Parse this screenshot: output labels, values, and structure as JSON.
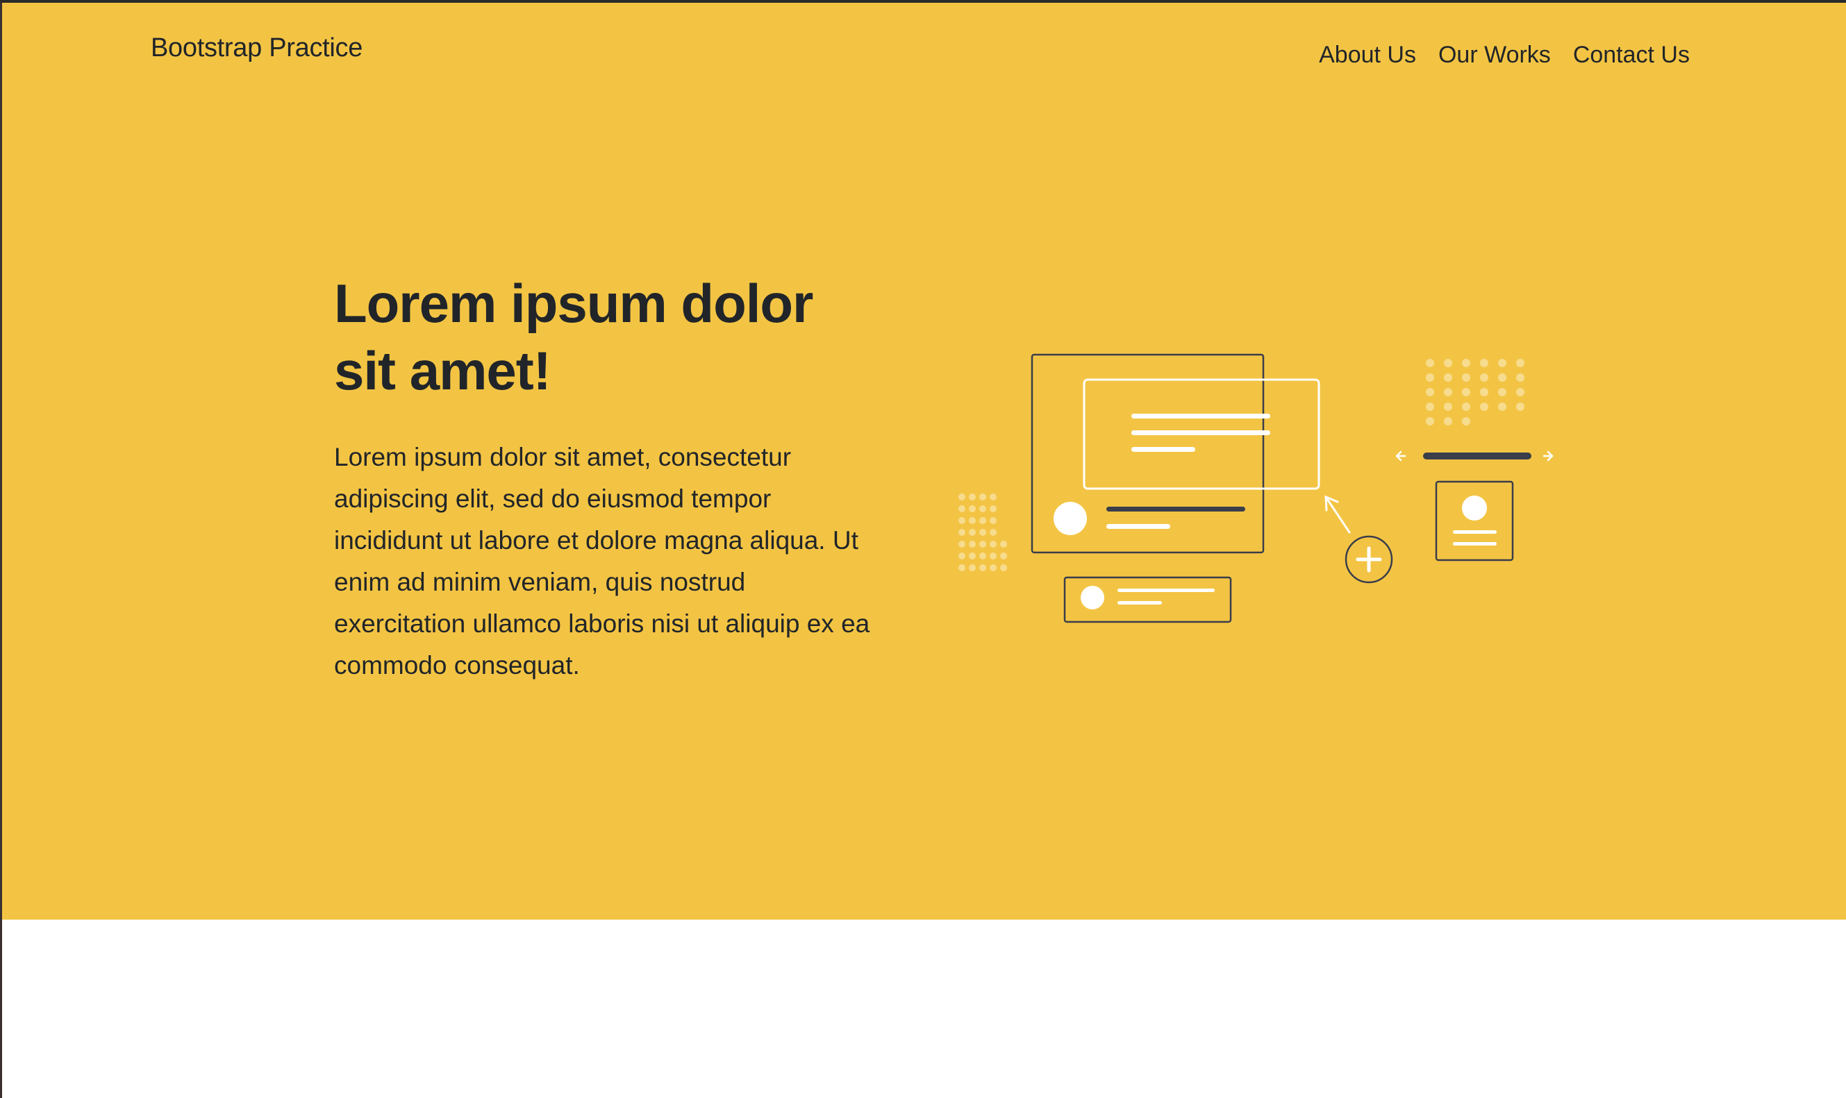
{
  "navbar": {
    "brand": "Bootstrap Practice",
    "links": [
      "About Us",
      "Our Works",
      "Contact Us"
    ]
  },
  "hero": {
    "title": "Lorem ipsum dolor sit amet!",
    "lead": "Lorem ipsum dolor sit amet, consectetur adipiscing elit, sed do eiusmod tempor incididunt ut labore et dolore magna aliqua. Ut enim ad minim veniam, quis nostrud exercitation ullamco laboris nisi ut aliquip ex ea commodo consequat.",
    "illustration_icon": "ui-wireframe-illustration"
  },
  "colors": {
    "hero_bg": "#f3c444",
    "text": "#212529",
    "page_bg": "#ffffff",
    "illustration_dark": "#3a3d4a",
    "illustration_light": "#ffffff"
  }
}
